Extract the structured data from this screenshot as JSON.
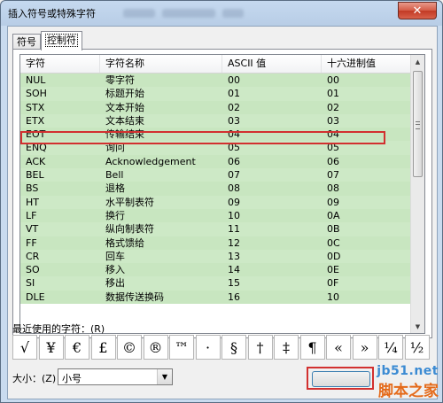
{
  "window": {
    "title": "插入符号或特殊字符",
    "close_glyph": "✕"
  },
  "tabs": [
    {
      "label": "符号"
    },
    {
      "label": "控制符"
    }
  ],
  "table": {
    "headers": [
      "字符",
      "字符名称",
      "ASCII 值",
      "十六进制值"
    ],
    "rows": [
      [
        "NUL",
        "零字符",
        "00",
        "00"
      ],
      [
        "SOH",
        "标题开始",
        "01",
        "01"
      ],
      [
        "STX",
        "文本开始",
        "02",
        "02"
      ],
      [
        "ETX",
        "文本结束",
        "03",
        "03"
      ],
      [
        "EOT",
        "传输结束",
        "04",
        "04"
      ],
      [
        "ENQ",
        "询问",
        "05",
        "05"
      ],
      [
        "ACK",
        "Acknowledgement",
        "06",
        "06"
      ],
      [
        "BEL",
        "Bell",
        "07",
        "07"
      ],
      [
        "BS",
        "退格",
        "08",
        "08"
      ],
      [
        "HT",
        "水平制表符",
        "09",
        "09"
      ],
      [
        "LF",
        "换行",
        "10",
        "0A"
      ],
      [
        "VT",
        "纵向制表符",
        "11",
        "0B"
      ],
      [
        "FF",
        "格式馈给",
        "12",
        "0C"
      ],
      [
        "CR",
        "回车",
        "13",
        "0D"
      ],
      [
        "SO",
        "移入",
        "14",
        "0E"
      ],
      [
        "SI",
        "移出",
        "15",
        "0F"
      ],
      [
        "DLE",
        "数据传送换码",
        "16",
        "10"
      ]
    ]
  },
  "recent": {
    "label": "最近使用的字符：(R)",
    "symbols": [
      "√",
      "¥",
      "€",
      "£",
      "©",
      "®",
      "™",
      "·",
      "§",
      "†",
      "‡",
      "¶",
      "«",
      "»",
      "¼",
      "½"
    ]
  },
  "size": {
    "label": "大小：(Z)",
    "value": "小号"
  },
  "watermark": {
    "line1": "jb51.net",
    "line2": "脚本之家"
  },
  "colors": {
    "row_bg": "#c8e6c0",
    "highlight_border": "#d2302f",
    "title_bar": "#c5d9ef"
  },
  "icons": {
    "close": "close-icon",
    "dropdown": "chevron-down-icon",
    "scroll_up": "arrow-up-icon",
    "scroll_down": "arrow-down-icon"
  }
}
